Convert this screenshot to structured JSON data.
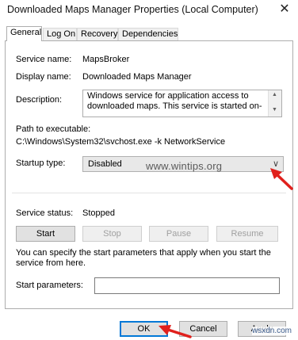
{
  "window": {
    "title": "Downloaded Maps Manager Properties (Local Computer)",
    "close_glyph": "✕"
  },
  "tabs": [
    {
      "label": "General",
      "active": true
    },
    {
      "label": "Log On",
      "active": false
    },
    {
      "label": "Recovery",
      "active": false
    },
    {
      "label": "Dependencies",
      "active": false
    }
  ],
  "general": {
    "service_name_label": "Service name:",
    "service_name": "MapsBroker",
    "display_name_label": "Display name:",
    "display_name": "Downloaded Maps Manager",
    "description_label": "Description:",
    "description": "Windows service for application access to downloaded maps. This service is started on-",
    "path_label": "Path to executable:",
    "path": "C:\\Windows\\System32\\svchost.exe -k NetworkService",
    "startup_type_label": "Startup type:",
    "startup_type": "Disabled",
    "watermark": "www.wintips.org",
    "status_label": "Service status:",
    "status": "Stopped",
    "buttons": {
      "start": "Start",
      "stop": "Stop",
      "pause": "Pause",
      "resume": "Resume"
    },
    "hint": "You can specify the start parameters that apply when you start the service from here.",
    "start_params_label": "Start parameters:",
    "start_params_value": ""
  },
  "footer": {
    "ok": "OK",
    "cancel": "Cancel",
    "apply": "Apply"
  },
  "corner_watermark": "wsxdn.com",
  "colors": {
    "arrow_red": "#e0201c",
    "ok_focus": "#0078d7"
  }
}
